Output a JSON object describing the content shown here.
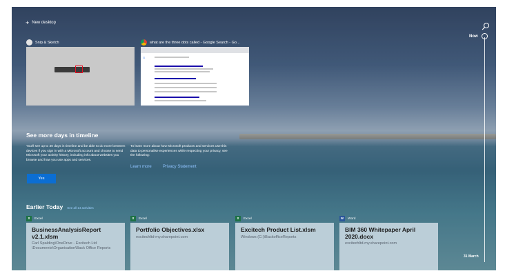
{
  "top": {
    "new_desktop": "New desktop"
  },
  "timeline": {
    "now": "Now",
    "date": "31 March"
  },
  "windows": [
    {
      "title": "Snip & Sketch",
      "icon": "snip-sketch-icon",
      "color": "#e4e4e4"
    },
    {
      "title": "what are the three dots called - Google Search - Go...",
      "icon": "chrome-icon",
      "color": "#dd4b39"
    }
  ],
  "promo": {
    "heading": "See more days in timeline",
    "left_text": "You'll see up to 30 days in timeline and be able to do more between devices if you sign in with a Microsoft account and choose to send Microsoft your activity history, including info about websites you browse and how you use apps and services.",
    "right_text": "To learn more about how Microsoft products and services use this data to personalise experiences while respecting your privacy, see the following:",
    "learn_more": "Learn more",
    "privacy": "Privacy Statement",
    "yes": "Yes"
  },
  "earlier": {
    "title": "Earlier Today",
    "see_all": "See all 14 activities",
    "cards": [
      {
        "app": "Excel",
        "app_color": "#1d7145",
        "glyph": "x",
        "title": "BusinessAnalysisReport v2.1.xlsm",
        "sub": "Carl Spalding\\OneDrive - Excitech Ltd \\Documents\\Organisation\\Back Office Reports"
      },
      {
        "app": "Excel",
        "app_color": "#1d7145",
        "glyph": "x",
        "title": "Portfolio Objectives.xlsx",
        "sub": "excitechltd-my.sharepoint.com"
      },
      {
        "app": "Excel",
        "app_color": "#1d7145",
        "glyph": "x",
        "title": "Excitech Product List.xlsm",
        "sub": "Windows (C:)\\BackofficeReports"
      },
      {
        "app": "Word",
        "app_color": "#2b579a",
        "glyph": "w",
        "title": "BIM 360 Whitepaper April 2020.docx",
        "sub": "excitechltd-my.sharepoint.com"
      }
    ]
  }
}
